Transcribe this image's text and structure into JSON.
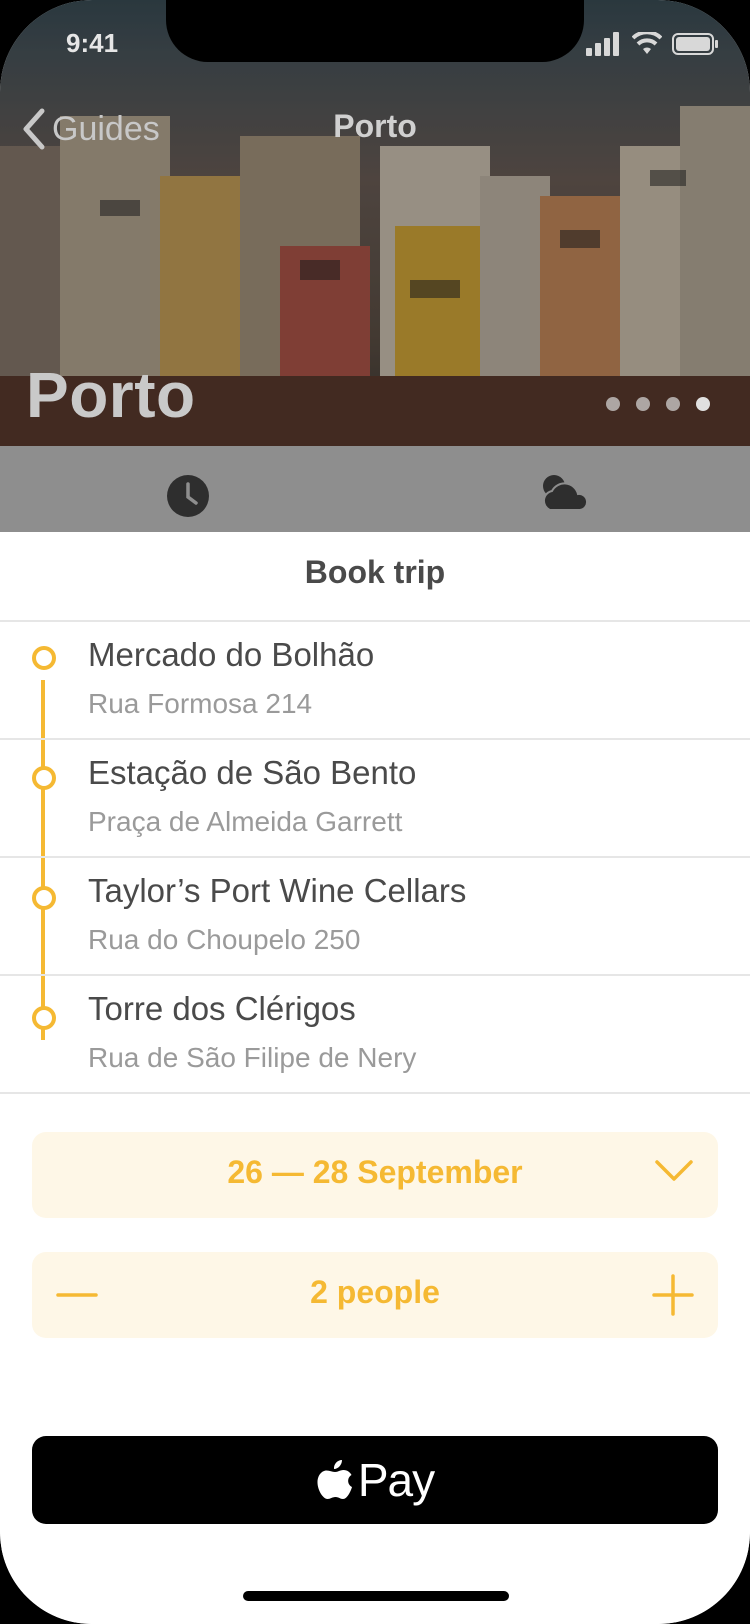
{
  "status_bar": {
    "time": "9:41"
  },
  "nav": {
    "back_label": "Guides",
    "title": "Porto"
  },
  "hero": {
    "title": "Porto",
    "page_count": 4,
    "active_page": 3
  },
  "sheet": {
    "title": "Book trip",
    "stops": [
      {
        "name": "Mercado do Bolhão",
        "address": "Rua Formosa 214"
      },
      {
        "name": "Estação de São Bento",
        "address": "Praça de Almeida Garrett"
      },
      {
        "name": "Taylor’s Port Wine Cellars",
        "address": "Rua do Choupelo 250"
      },
      {
        "name": "Torre dos Clérigos",
        "address": "Rua de São Filipe de Nery"
      }
    ],
    "dates": "26 — 28 September",
    "people": "2 people",
    "pay_label": "Pay"
  },
  "colors": {
    "accent": "#f5b933",
    "pill_bg": "#fef7e7",
    "text_primary": "#4a4a4a",
    "text_secondary": "#9a9a9a"
  },
  "icons": [
    "back-chevron-icon",
    "clock-icon",
    "weather-cloud-icon",
    "chevron-down-icon",
    "minus-icon",
    "plus-icon",
    "apple-logo-icon"
  ]
}
